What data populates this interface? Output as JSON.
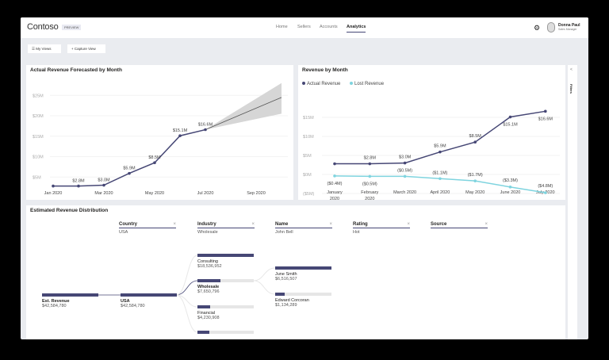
{
  "header": {
    "logo": "Contoso",
    "badge": "PREVIEW",
    "nav": [
      "Home",
      "Sellers",
      "Accounts",
      "Analytics"
    ],
    "active": "Analytics",
    "user_name": "Donna Paul",
    "user_role": "Sales Manager",
    "settings_icon": "gear-icon"
  },
  "toolbar": {
    "my_views": "☰ My Views",
    "capture_view": "+ Capture View"
  },
  "filters": {
    "label": "Filters",
    "collapse": "<"
  },
  "chart_data": [
    {
      "type": "line",
      "title": "Actual Revenue Forecasted by Month",
      "x": [
        "Jan 2020",
        "Feb 2020",
        "Mar 2020",
        "Apr 2020",
        "May 2020",
        "Jun 2020",
        "Jul 2020"
      ],
      "xticks": [
        "Jan 2020",
        "Mar 2020",
        "May 2020",
        "Jul 2020",
        "Sep 2020"
      ],
      "yticks": [
        "$5M",
        "$10M",
        "$15M",
        "$20M",
        "$25M"
      ],
      "ylim": [
        0,
        27
      ],
      "values": [
        2.8,
        2.8,
        3.0,
        5.9,
        8.5,
        15.1,
        16.6
      ],
      "labels": [
        "",
        "$2.8M",
        "$3.0M",
        "$5.9M",
        "$8.5M",
        "$15.1M",
        "$16.6M"
      ],
      "forecast": {
        "x": [
          "Jul 2020",
          "Oct 2020"
        ],
        "values": [
          16.6,
          24.5
        ],
        "upper": [
          16.6,
          28
        ],
        "lower": [
          16.6,
          20.5
        ]
      },
      "colors": {
        "line": "#464775",
        "forecast": "#555555",
        "band": "#d6d6d6"
      }
    },
    {
      "type": "line",
      "title": "Revenue by Month",
      "x": [
        "January 2020",
        "February 2020",
        "March 2020",
        "April 2020",
        "May 2020",
        "June 2020",
        "July 2020"
      ],
      "yticks": [
        "($5M)",
        "$0M",
        "$5M",
        "$10M",
        "$15M"
      ],
      "ylim": [
        -5,
        17
      ],
      "series": [
        {
          "name": "Actual Revenue",
          "color": "#464775",
          "values": [
            2.8,
            2.8,
            3.0,
            5.9,
            8.5,
            15.1,
            16.6
          ],
          "labels": [
            "",
            "$2.8M",
            "$3.0M",
            "$5.9M",
            "$8.5M",
            "$15.1M",
            "$16.6M"
          ]
        },
        {
          "name": "Lost Revenue",
          "color": "#7fd4df",
          "values": [
            -0.4,
            -0.5,
            -0.5,
            -1.1,
            -1.7,
            -3.3,
            -4.8
          ],
          "labels": [
            "($0.4M)",
            "($0.5M)",
            "($0.5M)",
            "($1.1M)",
            "($1.7M)",
            "($3.3M)",
            "($4.8M)"
          ]
        }
      ],
      "legend": "top-left"
    }
  ],
  "tree": {
    "title": "Estimated Revenue Distribution",
    "columns": [
      {
        "name": "Country",
        "value": "USA"
      },
      {
        "name": "Industry",
        "value": "Wholesale"
      },
      {
        "name": "Name",
        "value": "John Bell"
      },
      {
        "name": "Rating",
        "value": "Hot"
      },
      {
        "name": "Source",
        "value": ""
      }
    ],
    "root": {
      "label": "Est. Revenue",
      "value": "$42,584,780"
    },
    "country": {
      "label": "USA",
      "value": "$42,584,780"
    },
    "industries": [
      {
        "label": "Consulting",
        "value": "$18,536,952",
        "fill": 1.0
      },
      {
        "label": "Wholesale",
        "value": "$7,650,796",
        "fill": 0.41
      },
      {
        "label": "Financial",
        "value": "$4,230,908",
        "fill": 0.23
      },
      {
        "label": "",
        "value": "",
        "fill": 0.21
      }
    ],
    "names": [
      {
        "label": "June Smith",
        "value": "$6,516,507",
        "fill": 1.0
      },
      {
        "label": "Edward Corcoran",
        "value": "$1,134,289",
        "fill": 0.17
      }
    ]
  }
}
